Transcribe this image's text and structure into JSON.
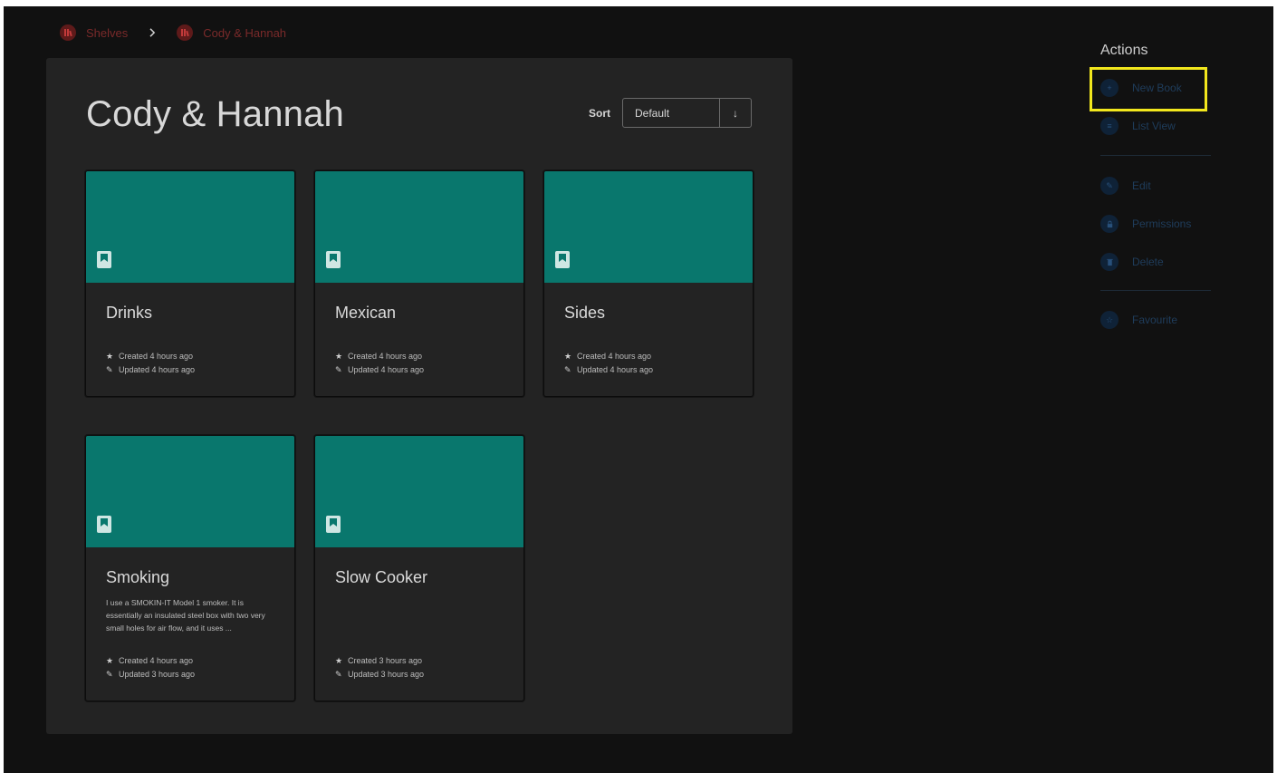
{
  "breadcrumb": {
    "items": [
      {
        "label": "Shelves",
        "icon": "shelf-icon"
      },
      {
        "label": "Cody & Hannah",
        "icon": "shelf-icon"
      }
    ],
    "separator": ">"
  },
  "page": {
    "title": "Cody & Hannah"
  },
  "sort": {
    "label": "Sort",
    "value": "Default",
    "direction_icon": "↓"
  },
  "books": [
    {
      "title": "Drinks",
      "description": "",
      "created": "Created 4 hours ago",
      "updated": "Updated 4 hours ago"
    },
    {
      "title": "Mexican",
      "description": "",
      "created": "Created 4 hours ago",
      "updated": "Updated 4 hours ago"
    },
    {
      "title": "Sides",
      "description": "",
      "created": "Created 4 hours ago",
      "updated": "Updated 4 hours ago"
    },
    {
      "title": "Smoking",
      "description": "I use a SMOKIN-IT Model 1 smoker. It is essentially an insulated steel box with two very small holes for air flow, and it uses ...",
      "created": "Created 4 hours ago",
      "updated": "Updated 3 hours ago"
    },
    {
      "title": "Slow Cooker",
      "description": "",
      "created": "Created 3 hours ago",
      "updated": "Updated 3 hours ago"
    }
  ],
  "actions": {
    "title": "Actions",
    "items": [
      {
        "label": "New Book",
        "icon": "plus-icon"
      },
      {
        "label": "List View",
        "icon": "list-icon"
      },
      {
        "label": "Edit",
        "icon": "pencil-icon"
      },
      {
        "label": "Permissions",
        "icon": "lock-icon"
      },
      {
        "label": "Delete",
        "icon": "trash-icon"
      },
      {
        "label": "Favourite",
        "icon": "star-icon"
      }
    ]
  },
  "colors": {
    "background": "#111111",
    "panel": "#232323",
    "cover": "#09776d",
    "highlight": "#f2e71d",
    "breadcrumb": "#7a2a2a",
    "action": "#1f3d5c"
  }
}
